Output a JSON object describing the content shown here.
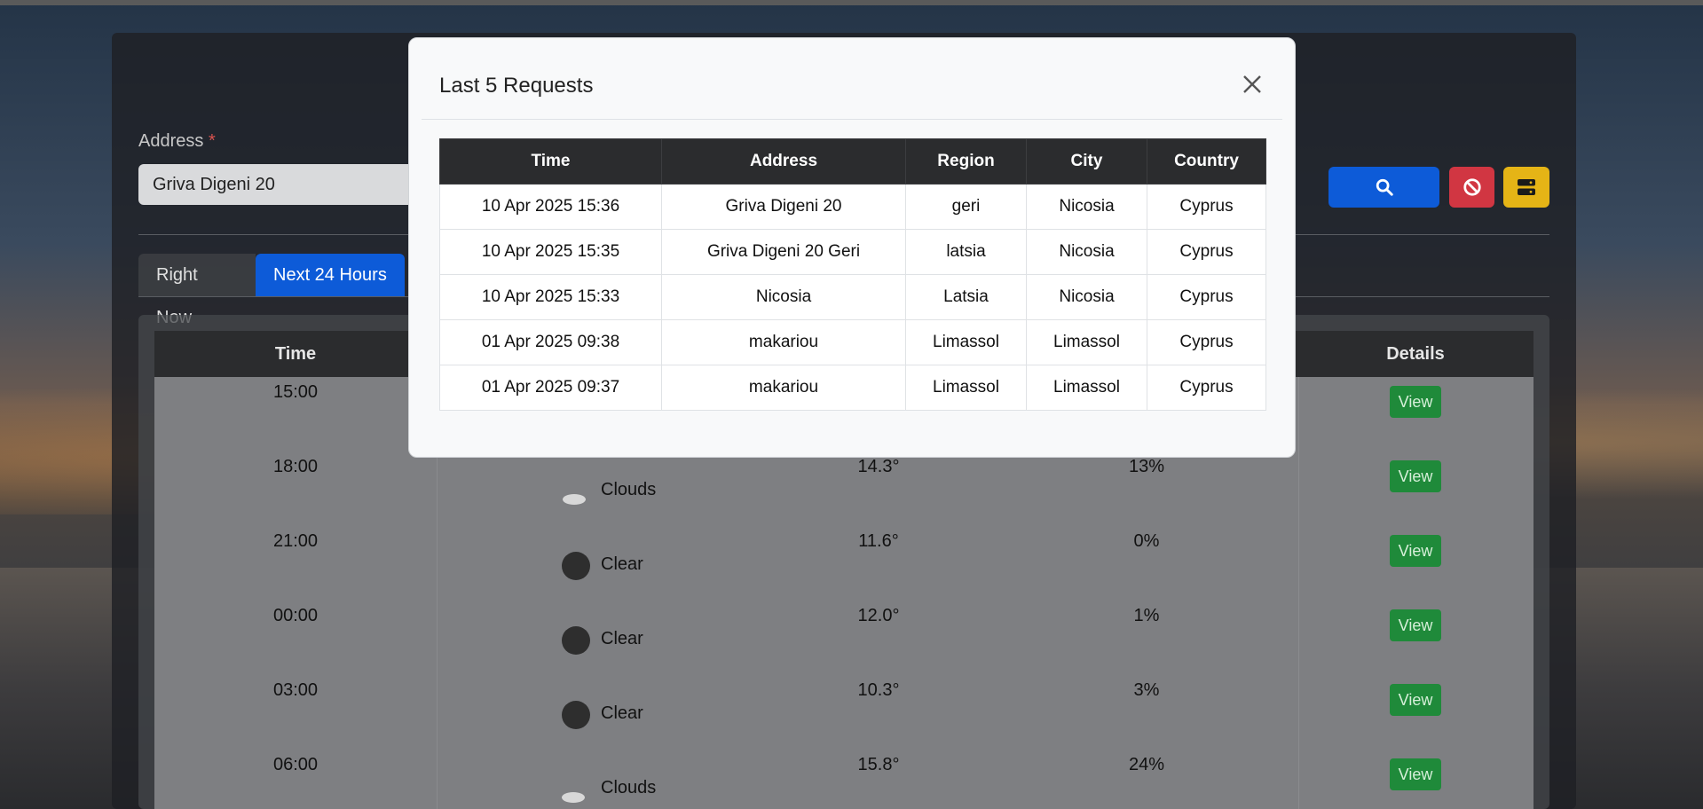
{
  "form": {
    "address_label": "Address",
    "required_mark": "*",
    "address_value": "Griva Digeni 20"
  },
  "tabs": [
    {
      "label": "Right Now"
    },
    {
      "label": "Next 24 Hours"
    }
  ],
  "forecast": {
    "headers": {
      "time": "Time",
      "details": "Details"
    },
    "rows": [
      {
        "time": "15:00",
        "condition": "",
        "temp": "",
        "humidity": "",
        "action": "View",
        "icon": "none"
      },
      {
        "time": "18:00",
        "condition": "Clouds",
        "temp": "14.3°",
        "humidity": "13%",
        "action": "View",
        "icon": "cloud-moon-icon"
      },
      {
        "time": "21:00",
        "condition": "Clear",
        "temp": "11.6°",
        "humidity": "0%",
        "action": "View",
        "icon": "moon-icon"
      },
      {
        "time": "00:00",
        "condition": "Clear",
        "temp": "12.0°",
        "humidity": "1%",
        "action": "View",
        "icon": "moon-icon"
      },
      {
        "time": "03:00",
        "condition": "Clear",
        "temp": "10.3°",
        "humidity": "3%",
        "action": "View",
        "icon": "moon-icon"
      },
      {
        "time": "06:00",
        "condition": "Clouds",
        "temp": "15.8°",
        "humidity": "24%",
        "action": "View",
        "icon": "cloud-sun-icon"
      }
    ]
  },
  "modal": {
    "title": "Last 5 Requests",
    "headers": [
      "Time",
      "Address",
      "Region",
      "City",
      "Country"
    ],
    "rows": [
      [
        "10 Apr 2025 15:36",
        "Griva Digeni 20",
        "geri",
        "Nicosia",
        "Cyprus"
      ],
      [
        "10 Apr 2025 15:35",
        "Griva Digeni 20 Geri",
        "latsia",
        "Nicosia",
        "Cyprus"
      ],
      [
        "10 Apr 2025 15:33",
        "Nicosia",
        "Latsia",
        "Nicosia",
        "Cyprus"
      ],
      [
        "01 Apr 2025 09:38",
        "makariou",
        "Limassol",
        "Limassol",
        "Cyprus"
      ],
      [
        "01 Apr 2025 09:37",
        "makariou",
        "Limassol",
        "Limassol",
        "Cyprus"
      ]
    ]
  },
  "colors": {
    "primary": "#0d5bd8",
    "danger": "#d13642",
    "warning": "#e5b416",
    "success": "#1f8a3a",
    "table_header": "#2b2c2e"
  }
}
